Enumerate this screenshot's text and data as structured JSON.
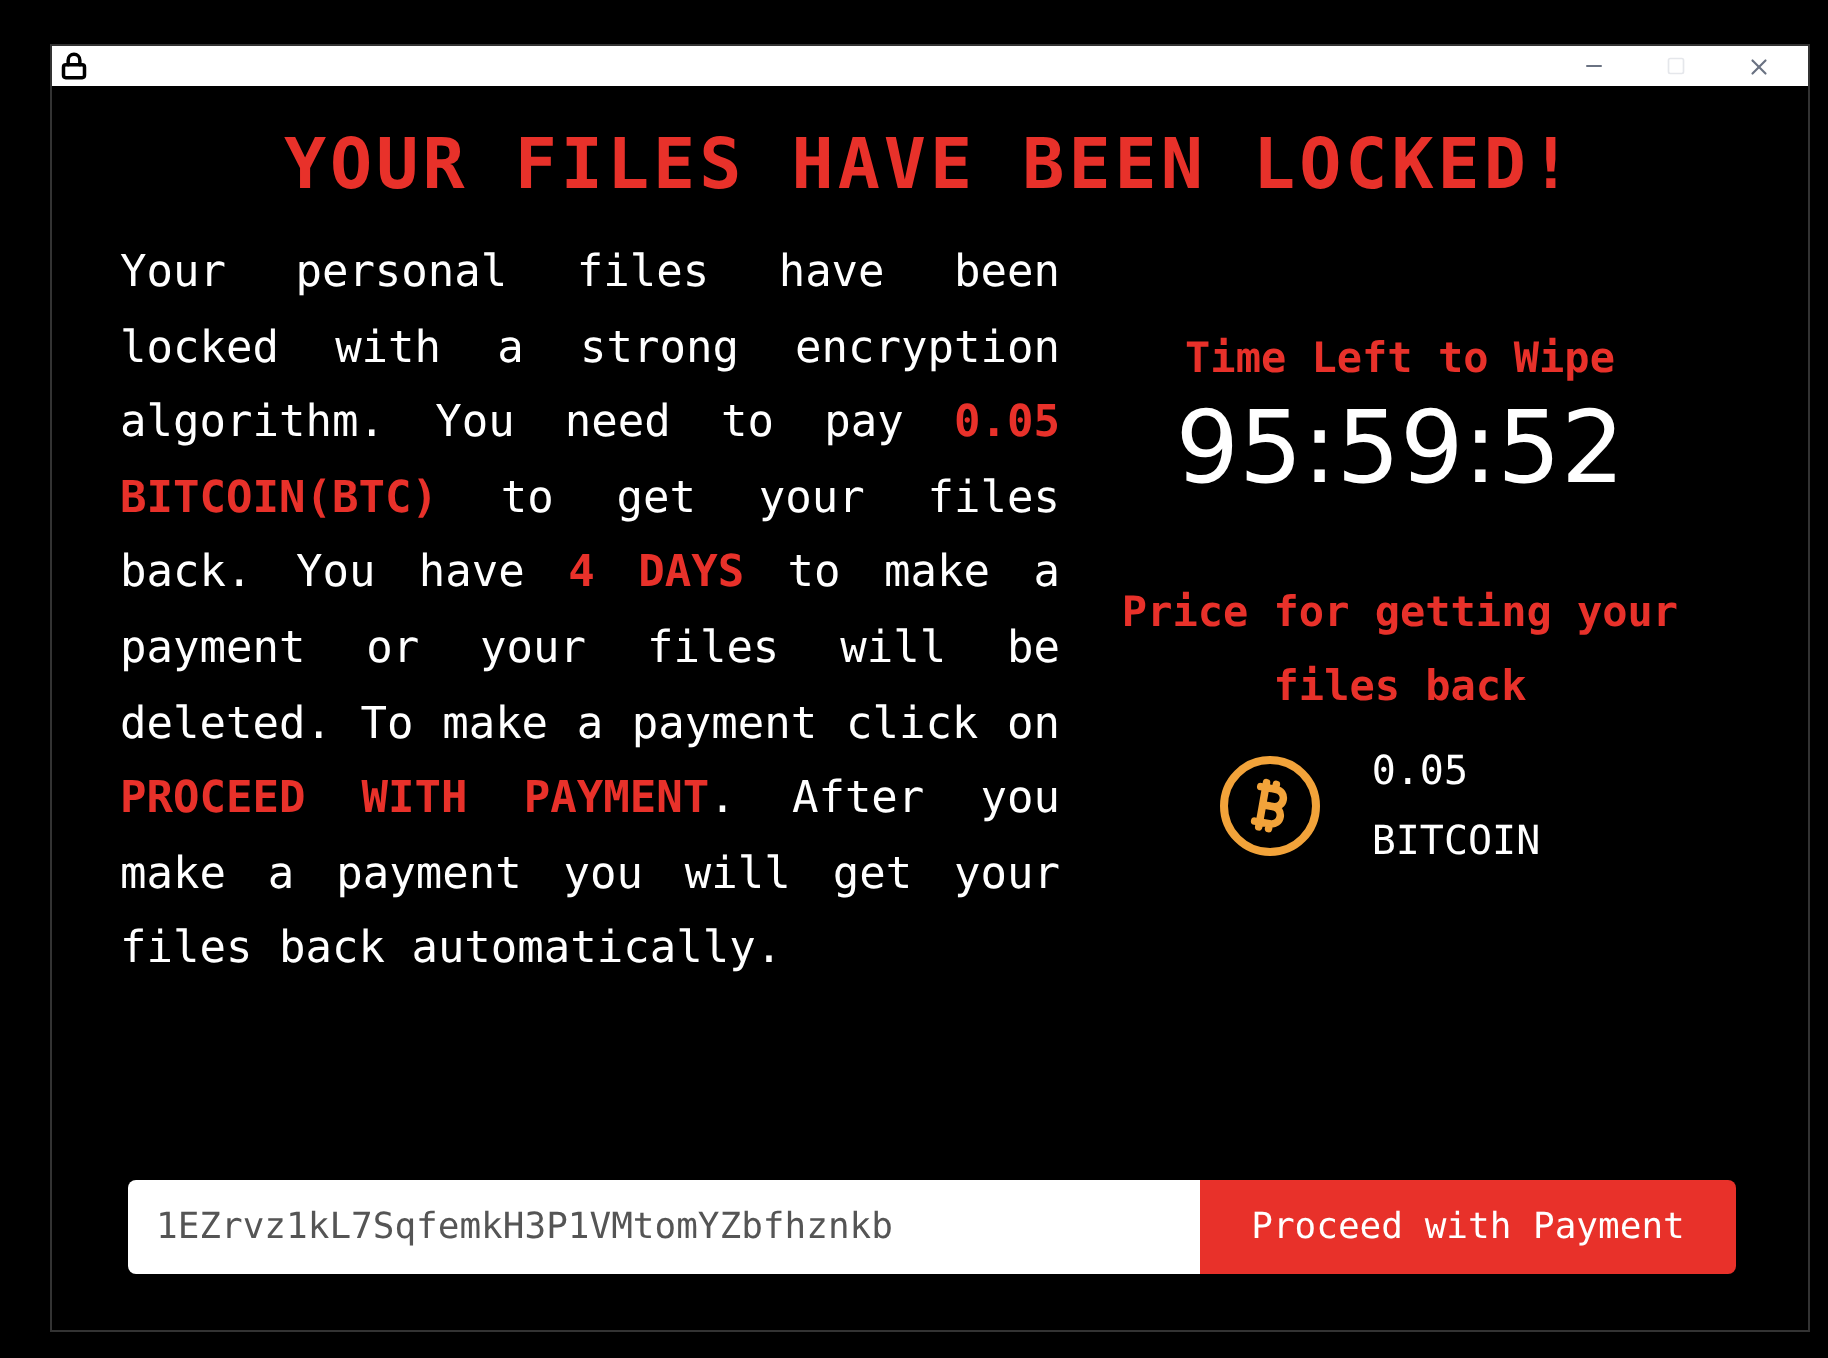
{
  "heading": "YOUR FILES HAVE BEEN LOCKED!",
  "message": "Your personal files have been locked with a strong encryption algorithm. You need to pay **0.05 BITCOIN(BTC)** to get your files back. You have **4 DAYS** to make a payment or your files will be deleted. To make a payment click on **PROCEED WITH PAYMENT**. After you make a payment you will get your files back automatically.",
  "timer": {
    "label": "Time Left to Wipe",
    "value": "95:59:52"
  },
  "price": {
    "label": "Price for getting your files back",
    "amount": "0.05",
    "currency": "BITCOIN"
  },
  "payment": {
    "address": "1EZrvz1kL7SqfemkH3P1VMtomYZbfhznkb",
    "button": "Proceed with Payment"
  }
}
